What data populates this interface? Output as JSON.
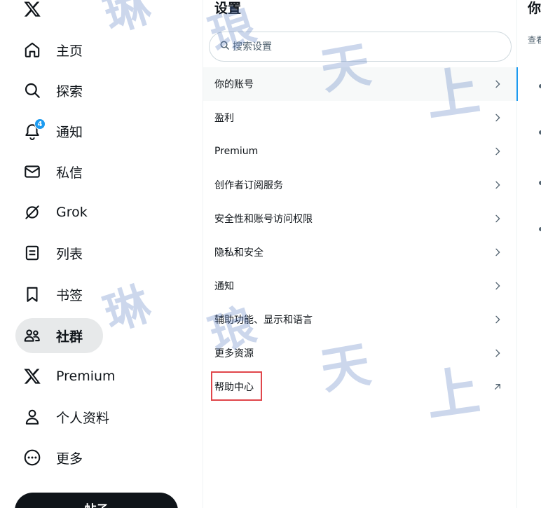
{
  "nav": {
    "items": [
      {
        "label": "主页",
        "icon": "home-icon"
      },
      {
        "label": "探索",
        "icon": "search-icon"
      },
      {
        "label": "通知",
        "icon": "bell-icon",
        "badge": "4"
      },
      {
        "label": "私信",
        "icon": "mail-icon"
      },
      {
        "label": "Grok",
        "icon": "grok-icon"
      },
      {
        "label": "列表",
        "icon": "list-icon"
      },
      {
        "label": "书签",
        "icon": "bookmark-icon"
      },
      {
        "label": "社群",
        "icon": "communities-icon",
        "active": true
      },
      {
        "label": "Premium",
        "icon": "x-logo-icon"
      },
      {
        "label": "个人资料",
        "icon": "person-icon"
      },
      {
        "label": "更多",
        "icon": "more-circle-icon"
      }
    ],
    "post_button": "帖子"
  },
  "settings": {
    "title": "设置",
    "search_placeholder": "搜索设置",
    "items": [
      {
        "label": "你的账号",
        "selected": true,
        "icon": "chevron-right-icon"
      },
      {
        "label": "盈利",
        "icon": "chevron-right-icon"
      },
      {
        "label": "Premium",
        "icon": "chevron-right-icon"
      },
      {
        "label": "创作者订阅服务",
        "icon": "chevron-right-icon"
      },
      {
        "label": "安全性和账号访问权限",
        "icon": "chevron-right-icon"
      },
      {
        "label": "隐私和安全",
        "icon": "chevron-right-icon"
      },
      {
        "label": "通知",
        "icon": "chevron-right-icon"
      },
      {
        "label": "辅助功能、显示和语言",
        "icon": "chevron-right-icon"
      },
      {
        "label": "更多资源",
        "icon": "chevron-right-icon"
      },
      {
        "label": "帮助中心",
        "icon": "external-link-icon",
        "highlighted": true
      }
    ]
  },
  "detail": {
    "title": "你",
    "desc": "查看"
  },
  "watermark": [
    "琳",
    "琅",
    "天",
    "上",
    "琳",
    "琅",
    "天",
    "上"
  ],
  "colors": {
    "accent": "#1d9bf0",
    "text": "#0f1419",
    "secondary": "#536471",
    "highlight_box": "#e0464b",
    "watermark": "#3f68b8"
  }
}
